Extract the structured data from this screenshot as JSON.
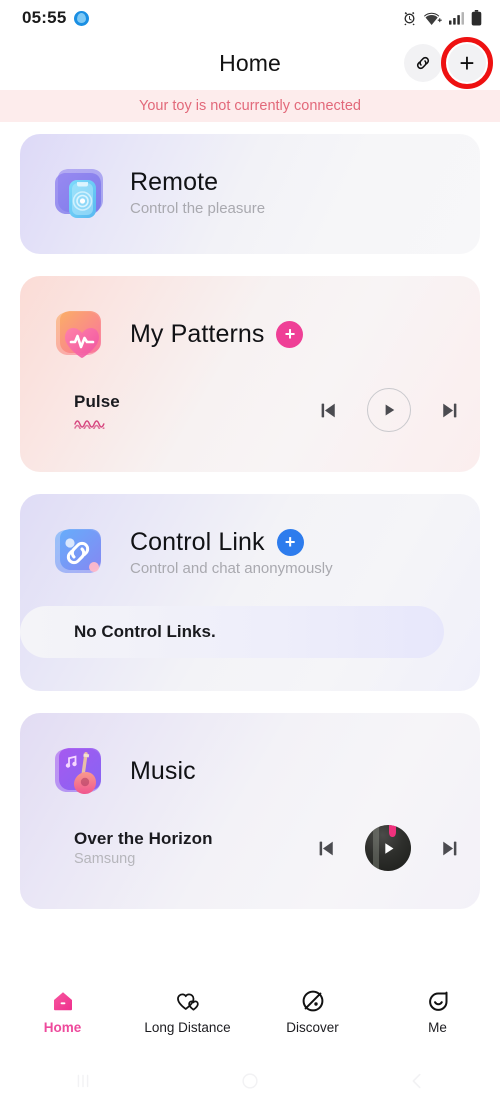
{
  "status_bar": {
    "time": "05:55",
    "left_icon": "loading-circle-icon",
    "icons": [
      "alarm-clock-icon",
      "wifi-plus-icon",
      "cellular-signal-icon",
      "battery-icon"
    ]
  },
  "header": {
    "title": "Home",
    "link_button_icon": "chain-link-icon",
    "add_button_label": "+",
    "highlight_color": "#ee1111"
  },
  "banner": {
    "message": "Your toy is not currently connected",
    "background": "#fdecec",
    "text_color": "#e2697a"
  },
  "cards": {
    "remote": {
      "title": "Remote",
      "subtitle": "Control the pleasure",
      "icon": "remote-phone-icon"
    },
    "patterns": {
      "title": "My Patterns",
      "icon": "heart-pulse-icon",
      "add_label": "+",
      "add_color": "#ef3f96",
      "track_name": "Pulse",
      "waveform_icon": "pulse-wave-icon",
      "controls": {
        "previous": "skip-previous-icon",
        "play": "play-icon",
        "next": "skip-next-icon"
      }
    },
    "control_link": {
      "title": "Control Link",
      "subtitle": "Control and chat anonymously",
      "icon": "chain-link-app-icon",
      "add_label": "+",
      "add_color": "#2d7ced",
      "empty_text": "No Control Links."
    },
    "music": {
      "title": "Music",
      "icon": "guitar-music-icon",
      "track_name": "Over the Horizon",
      "track_artist": "Samsung",
      "controls": {
        "previous": "skip-previous-icon",
        "play": "play-icon",
        "next": "skip-next-icon"
      }
    }
  },
  "tabbar": {
    "active_color": "#ee4a9c",
    "items": [
      {
        "label": "Home",
        "icon": "home-icon",
        "active": true
      },
      {
        "label": "Long Distance",
        "icon": "two-hearts-icon",
        "active": false
      },
      {
        "label": "Discover",
        "icon": "compass-leaf-icon",
        "active": false
      },
      {
        "label": "Me",
        "icon": "smiley-leaf-icon",
        "active": false
      }
    ]
  },
  "system_nav": {
    "recents": "recents-icon",
    "home": "home-circle-icon",
    "back": "back-chevron-icon"
  }
}
